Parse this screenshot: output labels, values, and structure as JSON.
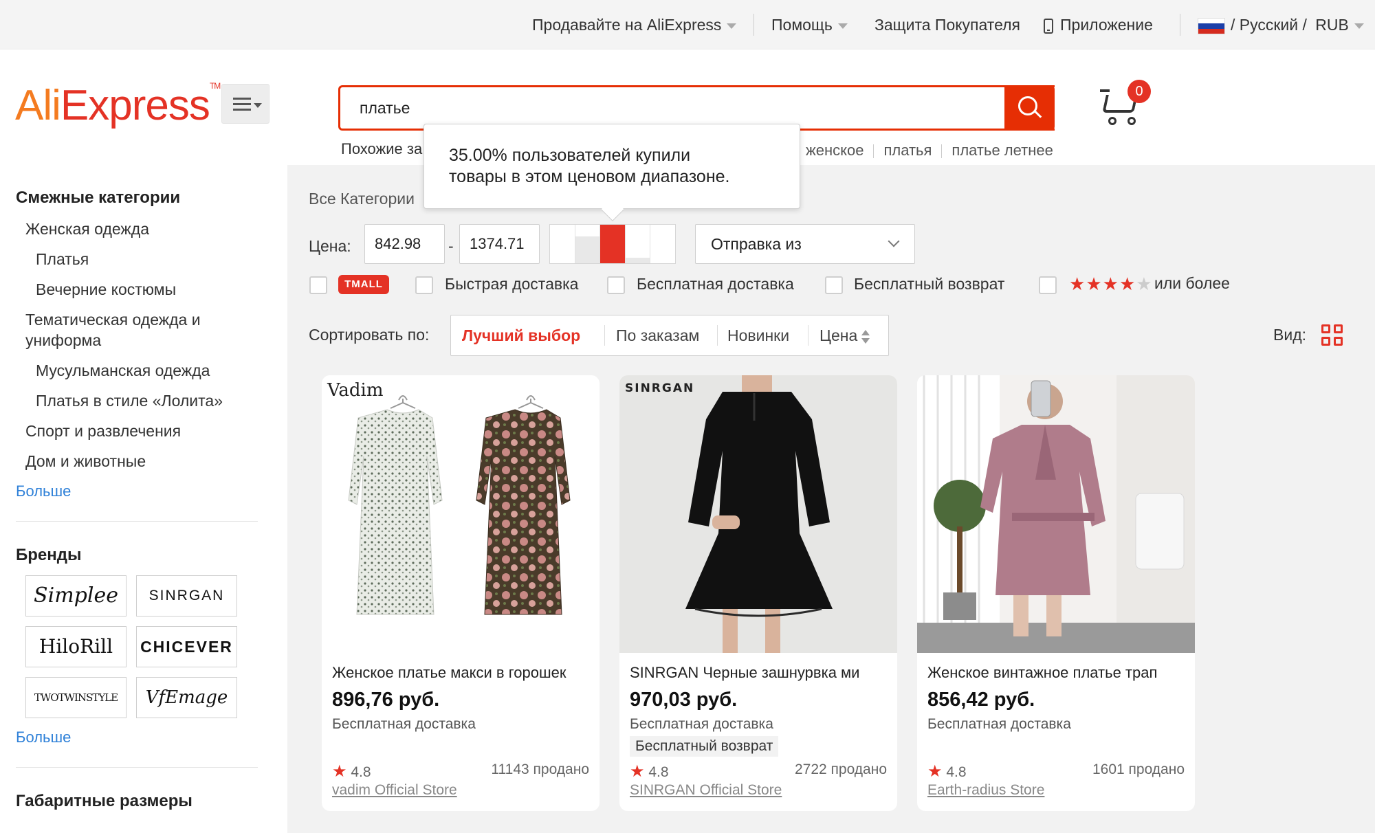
{
  "topbar": {
    "sell": "Продавайте на AliExpress",
    "help": "Помощь",
    "buyer_protection": "Защита Покупателя",
    "app": "Приложение",
    "locale": "/ Русский /",
    "currency": "RUB"
  },
  "header": {
    "logo_ali": "Ali",
    "logo_express": "Express",
    "logo_tm": "TM",
    "search_value": "платье",
    "cart_count": "0",
    "related_label": "Похожие за",
    "related_links": [
      "женское",
      "платья",
      "платье летнее"
    ]
  },
  "tooltip": {
    "line1": "35.00% пользователей купили",
    "line2": "товары в этом ценовом диапазоне."
  },
  "sidebar": {
    "related_title": "Смежные категории",
    "categories": [
      {
        "label": "Женская одежда",
        "level": 0
      },
      {
        "label": "Платья",
        "level": 1
      },
      {
        "label": "Вечерние костюмы",
        "level": 1
      },
      {
        "label": "Тематическая одежда и",
        "level": 0
      },
      {
        "label": "униформа",
        "level": 0
      },
      {
        "label": "Мусульманская одежда",
        "level": 1
      },
      {
        "label": "Платья в стиле «Лолита»",
        "level": 1
      },
      {
        "label": "Спорт и развлечения",
        "level": 0
      },
      {
        "label": "Дом и животные",
        "level": 0
      }
    ],
    "more_label": "Больше",
    "brands_title": "Бренды",
    "brands": [
      "Simplee",
      "SINRGAN",
      "HiloRill",
      "CHICEVER",
      "TWOTWINSTYLE",
      "VfEmage"
    ],
    "brands_more": "Больше",
    "size_title": "Габаритные размеры"
  },
  "filters": {
    "all_categories": "Все Категории",
    "price_label": "Цена:",
    "price_min": "842.98",
    "price_dash": "-",
    "price_max": "1374.71",
    "histogram": [
      0,
      0.7,
      1.0,
      0.15,
      0
    ],
    "histogram_selected": 2,
    "ship_from": "Отправка из",
    "tmall": "TMALL",
    "fast_delivery": "Быстрая доставка",
    "free_shipping": "Бесплатная доставка",
    "free_return": "Бесплатный возврат",
    "rating_stars": 4,
    "rating_more": "или более"
  },
  "sort": {
    "label": "Сортировать по:",
    "best": "Лучший выбор",
    "orders": "По заказам",
    "newest": "Новинки",
    "price": "Цена",
    "view_label": "Вид:"
  },
  "products": [
    {
      "brand_mark": "Vadim",
      "title": "Женское платье макси в горошек",
      "price": "896,76 руб.",
      "shipping": "Бесплатная доставка",
      "badge": "",
      "rating": "4.8",
      "sold": "11143 продано",
      "store": "vadim Official Store"
    },
    {
      "brand_mark": "SINRGAN",
      "title": "SINRGAN Черные зашнурвка ми",
      "price": "970,03 руб.",
      "shipping": "Бесплатная доставка",
      "badge": "Бесплатный возврат",
      "rating": "4.8",
      "sold": "2722 продано",
      "store": "SINRGAN Official Store"
    },
    {
      "brand_mark": "",
      "title": "Женское винтажное платье трап",
      "price": "856,42 руб.",
      "shipping": "Бесплатная доставка",
      "badge": "",
      "rating": "4.8",
      "sold": "1601 продано",
      "store": "Earth-radius Store"
    }
  ],
  "colors": {
    "accent": "#e43225",
    "search_border": "#e62e04",
    "link": "#2e80d8"
  }
}
